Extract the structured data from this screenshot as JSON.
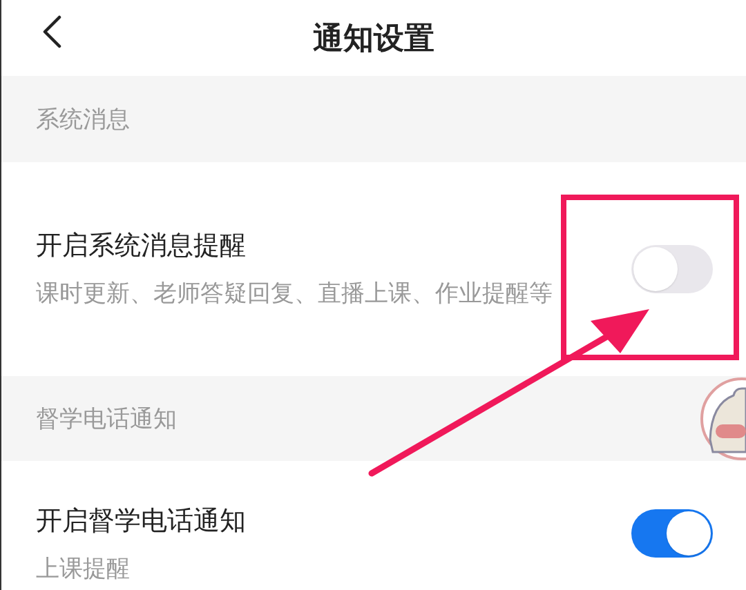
{
  "header": {
    "title": "通知设置"
  },
  "sections": [
    {
      "heading": "系统消息",
      "rows": [
        {
          "title": "开启系统消息提醒",
          "subtitle": "课时更新、老师答疑回复、直播上课、作业提醒等",
          "on": false
        }
      ]
    },
    {
      "heading": "督学电话通知",
      "rows": [
        {
          "title": "开启督学电话通知",
          "subtitle": "上课提醒",
          "on": true
        }
      ]
    }
  ]
}
